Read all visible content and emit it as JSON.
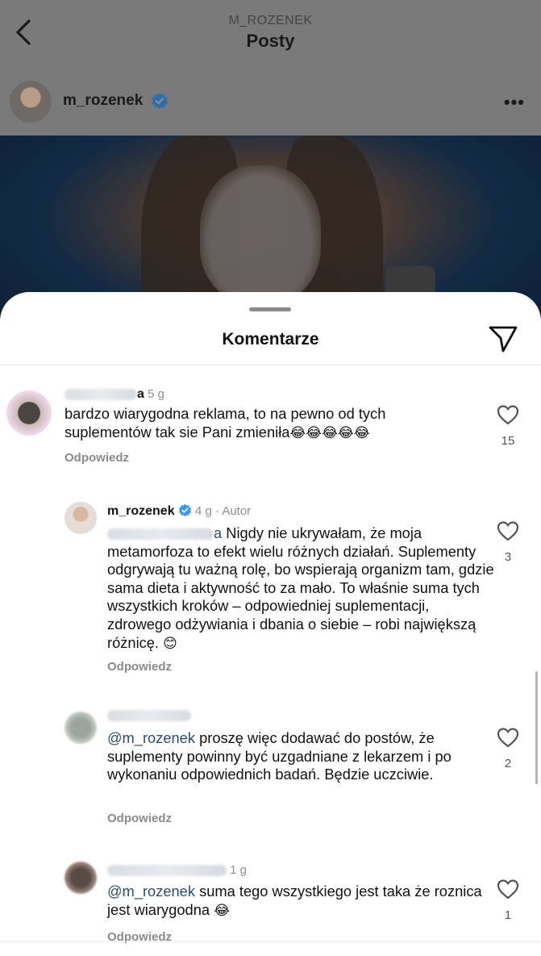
{
  "header": {
    "account_small": "M_ROZENEK",
    "title": "Posty"
  },
  "post": {
    "username": "m_rozenek",
    "more_label": "•••"
  },
  "sheet": {
    "title": "Komentarze"
  },
  "comments": [
    {
      "username_tail": "a",
      "time": "5 g",
      "text": "bardzo wiarygodna reklama, to na pewno od tych suplementów tak sie Pani zmieniła",
      "emoji": "😂😂😂😂😂",
      "reply_label": "Odpowiedz",
      "likes": "15"
    },
    {
      "username": "m_rozenek",
      "time": "4 g",
      "author_tag": "Autor",
      "mention_tail": "a",
      "text": " Nigdy nie ukrywałam, że moja metamorfoza to efekt wielu różnych działań. Suplementy odgrywają tu ważną rolę, bo wspierają organizm tam, gdzie sama dieta i aktywność to za mało. To właśnie suma tych wszystkich kroków – odpowiedniej suplementacji, zdrowego odżywiania i dbania o siebie – robi największą różnicę.",
      "emoji": "😊",
      "reply_label": "Odpowiedz",
      "likes": "3"
    },
    {
      "mention": "@m_rozenek",
      "text": " proszę więc dodawać do postów, że suplementy powinny być uzgadniane z lekarzem i po wykonaniu odpowiednich badań.  Będzie uczciwie.",
      "reply_label": "Odpowiedz",
      "likes": "2"
    },
    {
      "time": "1 g",
      "mention": "@m_rozenek",
      "text": " suma tego wszystkiego jest taka że roznica jest  wiarygodna",
      "emoji": "😂",
      "reply_label": "Odpowiedz",
      "likes": "1"
    }
  ],
  "colors": {
    "background_dim": "#7a7a7a",
    "verified_blue": "#3897f0",
    "mention": "#2a4d6e",
    "secondary_text": "#8e8e8e"
  }
}
